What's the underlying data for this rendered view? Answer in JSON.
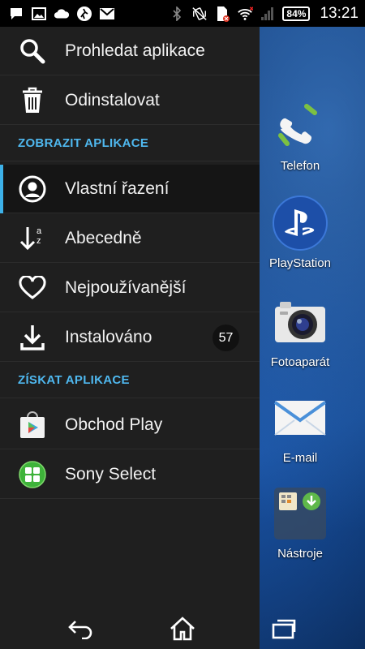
{
  "status_bar": {
    "time": "13:21",
    "battery": "84%",
    "icons_left": [
      "chat-icon",
      "image-icon",
      "cloud-icon",
      "walk-icon",
      "gmail-icon"
    ],
    "icons_right": [
      "bluetooth-icon",
      "vibrate-icon",
      "sim-error-icon",
      "wifi-icon",
      "signal-icon",
      "battery-icon"
    ]
  },
  "drawer": {
    "top_items": [
      {
        "label": "Prohledat aplikace",
        "icon": "search-icon"
      },
      {
        "label": "Odinstalovat",
        "icon": "trash-icon"
      }
    ],
    "section_show": "ZOBRAZIT APLIKACE",
    "show_items": [
      {
        "label": "Vlastní řazení",
        "icon": "person-circle-icon",
        "selected": true
      },
      {
        "label": "Abecedně",
        "icon": "sort-alpha-icon"
      },
      {
        "label": "Nejpoužívanější",
        "icon": "heart-icon"
      },
      {
        "label": "Instalováno",
        "icon": "download-icon",
        "badge": "57"
      }
    ],
    "section_get": "ZÍSKAT APLIKACE",
    "get_items": [
      {
        "label": "Obchod Play",
        "icon": "play-store-icon"
      },
      {
        "label": "Sony Select",
        "icon": "sony-select-icon"
      }
    ]
  },
  "dock": [
    {
      "label": "Telefon",
      "icon": "phone-icon"
    },
    {
      "label": "PlayStation",
      "icon": "playstation-icon"
    },
    {
      "label": "Fotoaparát",
      "icon": "camera-icon"
    },
    {
      "label": "E-mail",
      "icon": "email-icon"
    },
    {
      "label": "Nástroje",
      "icon": "tools-folder-icon"
    }
  ],
  "colors": {
    "accent": "#4fb8ef",
    "selection_bar": "#3db1e8",
    "drawer_bg": "#1f1f1f"
  }
}
